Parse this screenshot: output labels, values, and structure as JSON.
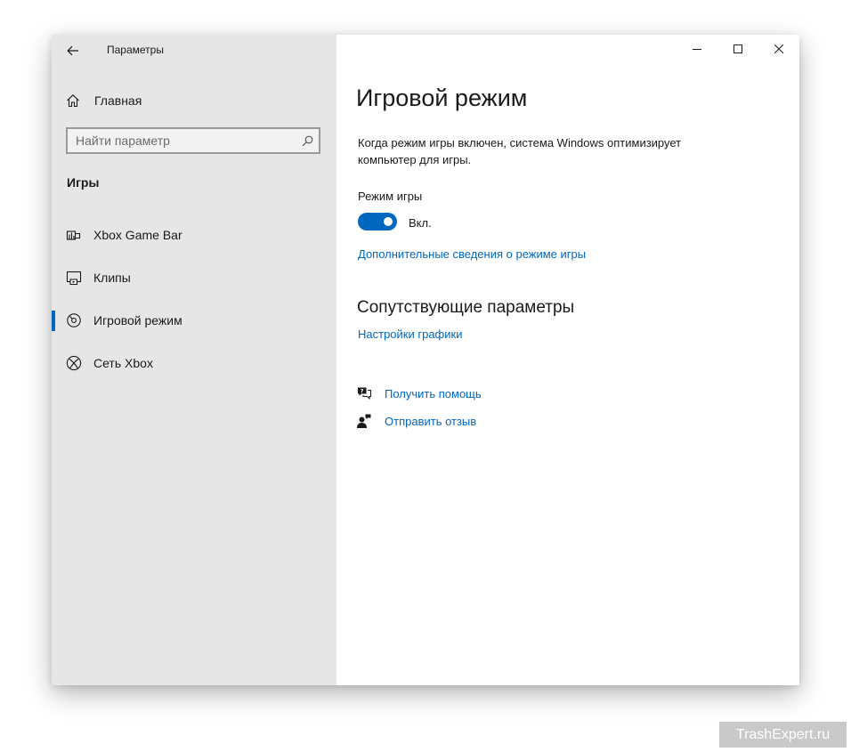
{
  "window": {
    "app_title": "Параметры",
    "controls": [
      "minimize-icon",
      "maximize-icon",
      "close-icon"
    ]
  },
  "sidebar": {
    "home_label": "Главная",
    "search": {
      "placeholder": "Найти параметр",
      "value": ""
    },
    "section_title": "Игры",
    "items": [
      {
        "label": "Xbox Game Bar",
        "icon": "game-bar-icon",
        "active": false
      },
      {
        "label": "Клипы",
        "icon": "clips-icon",
        "active": false
      },
      {
        "label": "Игровой режим",
        "icon": "game-mode-icon",
        "active": true
      },
      {
        "label": "Сеть Xbox",
        "icon": "xbox-icon",
        "active": false
      }
    ]
  },
  "main": {
    "title": "Игровой режим",
    "description": "Когда режим игры включен, система Windows оптимизирует компьютер для игры.",
    "setting_label": "Режим игры",
    "toggle_state": "Вкл.",
    "toggle_on": true,
    "more_info_link": "Дополнительные сведения о режиме игры",
    "related_title": "Сопутствующие параметры",
    "graphics_link": "Настройки графики",
    "help_link": "Получить помощь",
    "feedback_link": "Отправить отзыв"
  },
  "watermark": "TrashExpert.ru",
  "colors": {
    "accent": "#0067c0",
    "sidebar_bg": "#e6e6e6",
    "text": "#1a1a1a"
  }
}
